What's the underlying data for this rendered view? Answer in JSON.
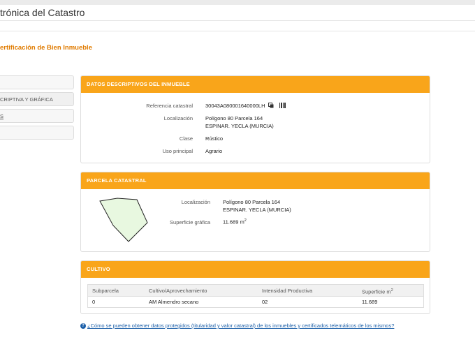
{
  "header": {
    "site_title": "trónica del Catastro"
  },
  "page": {
    "title": "ertificación de Bien Inmueble"
  },
  "sidebar": {
    "items": [
      {
        "label": ""
      },
      {
        "label": "CRIPTIVA Y GRÁFICA"
      },
      {
        "label": "S"
      },
      {
        "label": ""
      }
    ]
  },
  "descriptivos": {
    "heading": "DATOS DESCRIPTIVOS DEL INMUEBLE",
    "referencia_label": "Referencia catastral",
    "referencia_value": "30043A080001640000LH",
    "localizacion_label": "Localización",
    "localizacion_line1": "Polígono 80 Parcela 164",
    "localizacion_line2": "ESPINAR. YECLA (MURCIA)",
    "clase_label": "Clase",
    "clase_value": "Rústico",
    "uso_label": "Uso principal",
    "uso_value": "Agrario"
  },
  "parcela": {
    "heading": "PARCELA CATASTRAL",
    "localizacion_label": "Localización",
    "localizacion_line1": "Polígono 80 Parcela 164",
    "localizacion_line2": "ESPINAR. YECLA (MURCIA)",
    "superficie_label": "Superficie gráfica",
    "superficie_value": "11.689 m",
    "superficie_unit_exp": "2"
  },
  "cultivo": {
    "heading": "CULTIVO",
    "columns": [
      "Subparcela",
      "Cultivo/Aprovechamiento",
      "Intensidad Productiva",
      "Superficie m"
    ],
    "columns_exp": "2",
    "rows": [
      [
        "0",
        "AM Almendro secano",
        "02",
        "11.689"
      ]
    ]
  },
  "help": {
    "link_text": "¿Cómo se pueden obtener datos protegidos (titularidad y valor catastral) de los inmuebles y certificados telemáticos de los mismos?"
  },
  "colors": {
    "accent": "#f9a51a",
    "title": "#e07b00",
    "link": "#1a5ea8",
    "parcel_fill": "#e8f8e0"
  }
}
